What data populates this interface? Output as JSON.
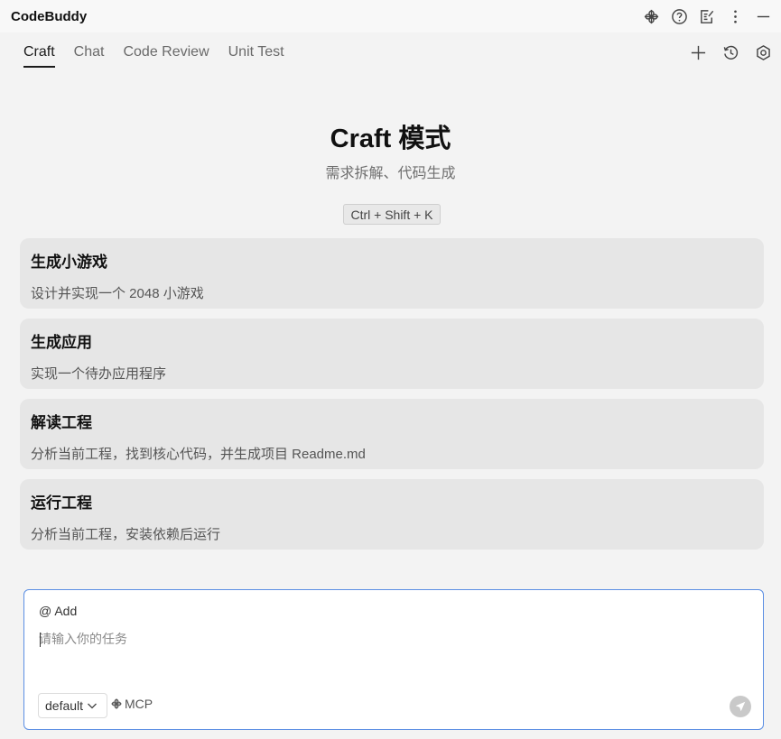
{
  "app": {
    "title": "CodeBuddy"
  },
  "titlebar_icons": [
    "mcp-icon",
    "help-icon",
    "notes-icon",
    "more-icon",
    "minimize-icon"
  ],
  "tabs": [
    {
      "label": "Craft",
      "active": true
    },
    {
      "label": "Chat",
      "active": false
    },
    {
      "label": "Code Review",
      "active": false
    },
    {
      "label": "Unit Test",
      "active": false
    }
  ],
  "tab_actions": [
    "plus-icon",
    "history-icon",
    "settings-icon"
  ],
  "hero": {
    "title": "Craft 模式",
    "subtitle": "需求拆解、代码生成",
    "shortcut": "Ctrl + Shift + K"
  },
  "cards": [
    {
      "title": "生成小游戏",
      "desc": "设计并实现一个 2048 小游戏"
    },
    {
      "title": "生成应用",
      "desc": "实现一个待办应用程序"
    },
    {
      "title": "解读工程",
      "desc": "分析当前工程，找到核心代码，并生成项目 Readme.md"
    },
    {
      "title": "运行工程",
      "desc": "分析当前工程，安装依赖后运行"
    }
  ],
  "composer": {
    "add_label": "@ Add",
    "placeholder": "请输入你的任务",
    "value": "",
    "model": "default",
    "mcp_label": "MCP"
  },
  "colors": {
    "background": "#f3f3f3",
    "card": "#e6e6e6",
    "composer_border": "#5b8ee3",
    "send_button": "#c9c9c9"
  }
}
